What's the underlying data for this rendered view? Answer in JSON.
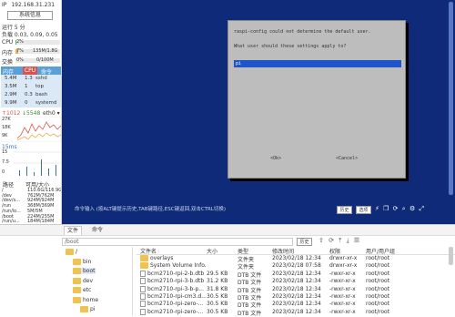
{
  "sidebar": {
    "ip_label": "IP",
    "ip_value": "192.168.31.231",
    "sys_info_button": "系统信息",
    "uptime": "运行 5 分",
    "load": "负载 0.03, 0.09, 0.05",
    "cpu_label": "CPU",
    "cpu_value": "2%",
    "mem_label": "内存",
    "mem_pct": "7%",
    "mem_value": "135M/1.8G",
    "swap_label": "交换",
    "swap_pct": "0%",
    "swap_value": "0/100M",
    "proc_headers": [
      "内存",
      "CPU",
      "命令"
    ],
    "processes": [
      {
        "mem": "5.4M",
        "cpu": "1.3",
        "cmd": "sshd"
      },
      {
        "mem": "3.5M",
        "cpu": "1",
        "cmd": "top"
      },
      {
        "mem": "2.9M",
        "cpu": "0.3",
        "cmd": "bash"
      },
      {
        "mem": "9.9M",
        "cpu": "0",
        "cmd": "systemd"
      }
    ],
    "net_up": "↑1012",
    "net_down": "↓5548",
    "net_iface": "eth0",
    "net_scale": [
      "27K",
      "18K",
      "9K"
    ],
    "ping_label": "15ms",
    "ping_scale": [
      "15",
      "7.5",
      "0"
    ],
    "disk_headers": [
      "路径",
      "可用/大小"
    ],
    "disks": [
      {
        "path": "/",
        "size": "110.6G/116.9G"
      },
      {
        "path": "/dev",
        "size": "762M/762M"
      },
      {
        "path": "/dev/s...",
        "size": "924M/924M"
      },
      {
        "path": "/run",
        "size": "368M/369M"
      },
      {
        "path": "/run/lo...",
        "size": "5M/5M"
      },
      {
        "path": "/boot",
        "size": "224M/255M"
      },
      {
        "path": "/run/u...",
        "size": "184M/184M"
      }
    ]
  },
  "terminal": {
    "dialog_title": "raspi-config could not determine the default user.",
    "dialog_prompt": "What user should these settings apply to?",
    "input_value": "pi",
    "ok_button": "<Ok>",
    "cancel_button": "<Cancel>"
  },
  "statusbar": {
    "hint": "命令输入 (按ALT键提示历史,TAB键路径,ESC键返回,双击CTRL切换)",
    "history_button": "历史",
    "options_button": "选项"
  },
  "files": {
    "tabs": [
      "文件",
      "命令"
    ],
    "path_value": "/boot",
    "history_button": "历史",
    "tree": [
      {
        "name": "/",
        "indent": 0
      },
      {
        "name": "bin",
        "indent": 1
      },
      {
        "name": "boot",
        "indent": 1
      },
      {
        "name": "dev",
        "indent": 1
      },
      {
        "name": "etc",
        "indent": 1
      },
      {
        "name": "home",
        "indent": 1
      },
      {
        "name": "pi",
        "indent": 2
      }
    ],
    "columns": [
      "文件名",
      "大小",
      "类型",
      "修改时间",
      "权限",
      "用户/用户组"
    ],
    "rows": [
      {
        "name": "overlays",
        "size": "",
        "type": "文件夹",
        "mtime": "2023/02/18 12:34",
        "perm": "drwxr-xr-x",
        "owner": "root/root",
        "folder": true
      },
      {
        "name": "System Volume Info...",
        "size": "",
        "type": "文件夹",
        "mtime": "2023/02/18 07:58",
        "perm": "drwxr-xr-x",
        "owner": "root/root",
        "folder": true
      },
      {
        "name": "bcm2710-rpi-2-b.dtb",
        "size": "29.5 KB",
        "type": "DTB 文件",
        "mtime": "2023/02/18 12:34",
        "perm": "-rwxr-xr-x",
        "owner": "root/root",
        "folder": false
      },
      {
        "name": "bcm2710-rpi-3-b.dtb",
        "size": "31.2 KB",
        "type": "DTB 文件",
        "mtime": "2023/02/18 12:34",
        "perm": "-rwxr-xr-x",
        "owner": "root/root",
        "folder": false
      },
      {
        "name": "bcm2710-rpi-3-b-p...",
        "size": "31.8 KB",
        "type": "DTB 文件",
        "mtime": "2023/02/18 12:34",
        "perm": "-rwxr-xr-x",
        "owner": "root/root",
        "folder": false
      },
      {
        "name": "bcm2710-rpi-cm3.d...",
        "size": "30.5 KB",
        "type": "DTB 文件",
        "mtime": "2023/02/18 12:34",
        "perm": "-rwxr-xr-x",
        "owner": "root/root",
        "folder": false
      },
      {
        "name": "bcm2710-rpi-zero-...",
        "size": "30.5 KB",
        "type": "DTB 文件",
        "mtime": "2023/02/18 12:34",
        "perm": "-rwxr-xr-x",
        "owner": "root/root",
        "folder": false
      },
      {
        "name": "bcm2710-rpi-zero-...",
        "size": "30.5 KB",
        "type": "DTB 文件",
        "mtime": "2023/02/18 12:34",
        "perm": "-rwxr-xr-x",
        "owner": "root/root",
        "folder": false
      }
    ]
  },
  "colors": {
    "terminal_bg": "#0e2a78",
    "dialog_bg": "#bdbdbd",
    "input_bg": "#1f55c9",
    "cpu_red": "#d9534f",
    "proc_header_bg": "#5aa0d8",
    "folder": "#f0c24e"
  }
}
